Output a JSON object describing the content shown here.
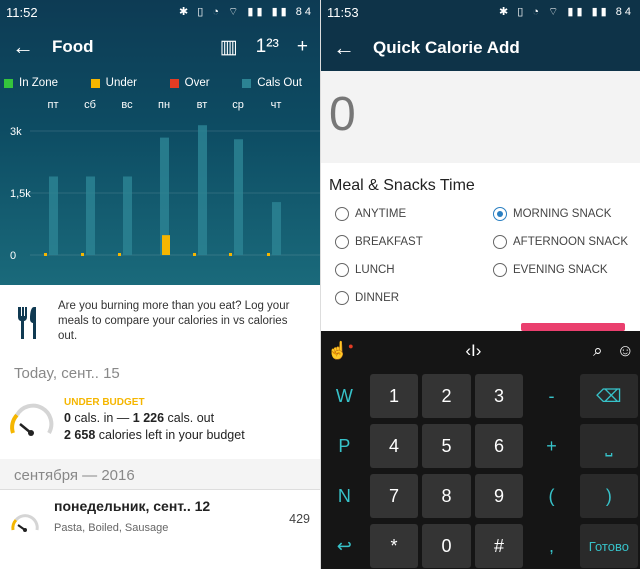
{
  "left": {
    "status": {
      "time": "11:52",
      "battery": "84"
    },
    "appbar": {
      "title": "Food",
      "back": "←",
      "barcode": "▥",
      "quick": "1²³",
      "add": "+"
    },
    "legend": [
      {
        "label": "In Zone",
        "color": "#34c43c"
      },
      {
        "label": "Under",
        "color": "#f5b600"
      },
      {
        "label": "Over",
        "color": "#e23c24"
      },
      {
        "label": "Cals Out",
        "color": "#2c8393"
      }
    ],
    "chart_data": {
      "type": "bar",
      "categories": [
        "пт",
        "сб",
        "вс",
        "пн",
        "вт",
        "ср",
        "чт"
      ],
      "yticks": [
        "3k",
        "1,5k",
        "0"
      ],
      "ylim": [
        0,
        3000
      ],
      "series": [
        {
          "name": "Cals Out",
          "values": [
            1900,
            1900,
            1900,
            2840,
            3140,
            2800,
            1280
          ],
          "color": "#2c8393"
        },
        {
          "name": "Under",
          "values": [
            0,
            0,
            0,
            480,
            0,
            0,
            0
          ],
          "color": "#f5b600"
        }
      ],
      "grid": true
    },
    "cta_text": "Are you burning more than you eat? Log your meals to compare your calories in vs calories out.",
    "today_header": "Today, сент.. 15",
    "budget": {
      "label": "UNDER BUDGET",
      "line1_in": "0",
      "line1_a": " cals. in — ",
      "line1_out": "1 226",
      "line1_b": " cals. out",
      "line2_num": "2 658",
      "line2_rest": " calories left in your budget"
    },
    "month_header": "сентября — 2016",
    "day": {
      "name": "понедельник, сент.. 12",
      "foods": "Pasta, Boiled, Sausage",
      "cals": "429"
    }
  },
  "right": {
    "status": {
      "time": "11:53",
      "battery": "84"
    },
    "appbar": {
      "title": "Quick Calorie Add",
      "back": "←"
    },
    "amount": "0",
    "meal_title": "Meal & Snacks Time",
    "options": [
      {
        "label": "ANYTIME",
        "selected": false
      },
      {
        "label": "MORNING SNACK",
        "selected": true
      },
      {
        "label": "BREAKFAST",
        "selected": false
      },
      {
        "label": "AFTERNOON SNACK",
        "selected": false
      },
      {
        "label": "LUNCH",
        "selected": false
      },
      {
        "label": "EVENING SNACK",
        "selected": false
      },
      {
        "label": "DINNER",
        "selected": false
      }
    ],
    "keyboard": {
      "rows": [
        {
          "side": "W",
          "keys": [
            "1",
            "2",
            "3"
          ],
          "fn": "-",
          "end": "⌫"
        },
        {
          "side": "P",
          "keys": [
            "4",
            "5",
            "6"
          ],
          "fn": "+",
          "end": "⎵"
        },
        {
          "side": "N",
          "keys": [
            "7",
            "8",
            "9"
          ],
          "fn": "(",
          "end": ")"
        },
        {
          "side": "↩",
          "keys": [
            "*",
            "0",
            "#"
          ],
          "fn": ",",
          "end": "Готово"
        }
      ]
    }
  }
}
